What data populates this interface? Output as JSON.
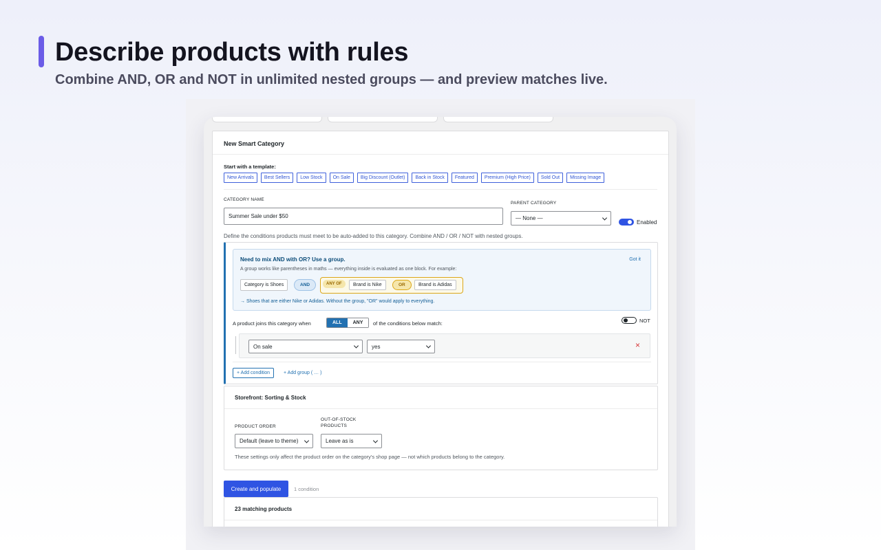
{
  "hero": {
    "title": "Describe products with rules",
    "subtitle": "Combine AND, OR and NOT in unlimited nested groups — and preview matches live."
  },
  "panel": {
    "title": "New Smart Category",
    "template_label": "Start with a template:",
    "templates": [
      "New Arrivals",
      "Best Sellers",
      "Low Stock",
      "On Sale",
      "Big Discount (Outlet)",
      "Back in Stock",
      "Featured",
      "Premium (High Price)",
      "Sold Out",
      "Missing Image"
    ],
    "category_name_label": "CATEGORY NAME",
    "category_name_value": "Summer Sale under $50",
    "parent_label": "PARENT CATEGORY",
    "parent_value": "— None —",
    "enabled_label": "Enabled",
    "define_text": "Define the conditions products must meet to be auto-added to this category. Combine AND / OR / NOT with nested groups."
  },
  "help": {
    "title": "Need to mix AND with OR? Use a group.",
    "dismiss": "Got it",
    "body": "A group works like parentheses in maths — everything inside is evaluated as one block. For example:",
    "chip1": "Category is Shoes",
    "and": "AND",
    "any_of": "ANY OF",
    "chip2": "Brand is Nike",
    "or": "OR",
    "chip3": "Brand is Adidas",
    "result": "→ Shoes that are either Nike or Adidas. Without the group, \"OR\" would apply to everything."
  },
  "rules": {
    "joins_prefix": "A product joins this category when",
    "all": "ALL",
    "any": "ANY",
    "joins_suffix": "of the conditions below match:",
    "not_label": "NOT",
    "condition_field": "On sale",
    "condition_value": "yes",
    "remove": "×",
    "add_condition": "+ Add condition",
    "add_group": "+ Add group ( … )"
  },
  "storefront": {
    "title": "Storefront: Sorting & Stock",
    "order_label": "PRODUCT ORDER",
    "order_value": "Default (leave to theme)",
    "oos_label_1": "OUT-OF-STOCK",
    "oos_label_2": "PRODUCTS",
    "oos_value": "Leave as is",
    "note": "These settings only affect the product order on the category's shop page — not which products belong to the category."
  },
  "actions": {
    "create": "Create and populate",
    "count": "1 condition"
  },
  "matches": {
    "title": "23 matching products"
  },
  "colors": {
    "accent": "#2f54e3",
    "wp_blue": "#2271b1",
    "hero_bar": "#6b5ce7",
    "remove_red": "#d63638"
  }
}
